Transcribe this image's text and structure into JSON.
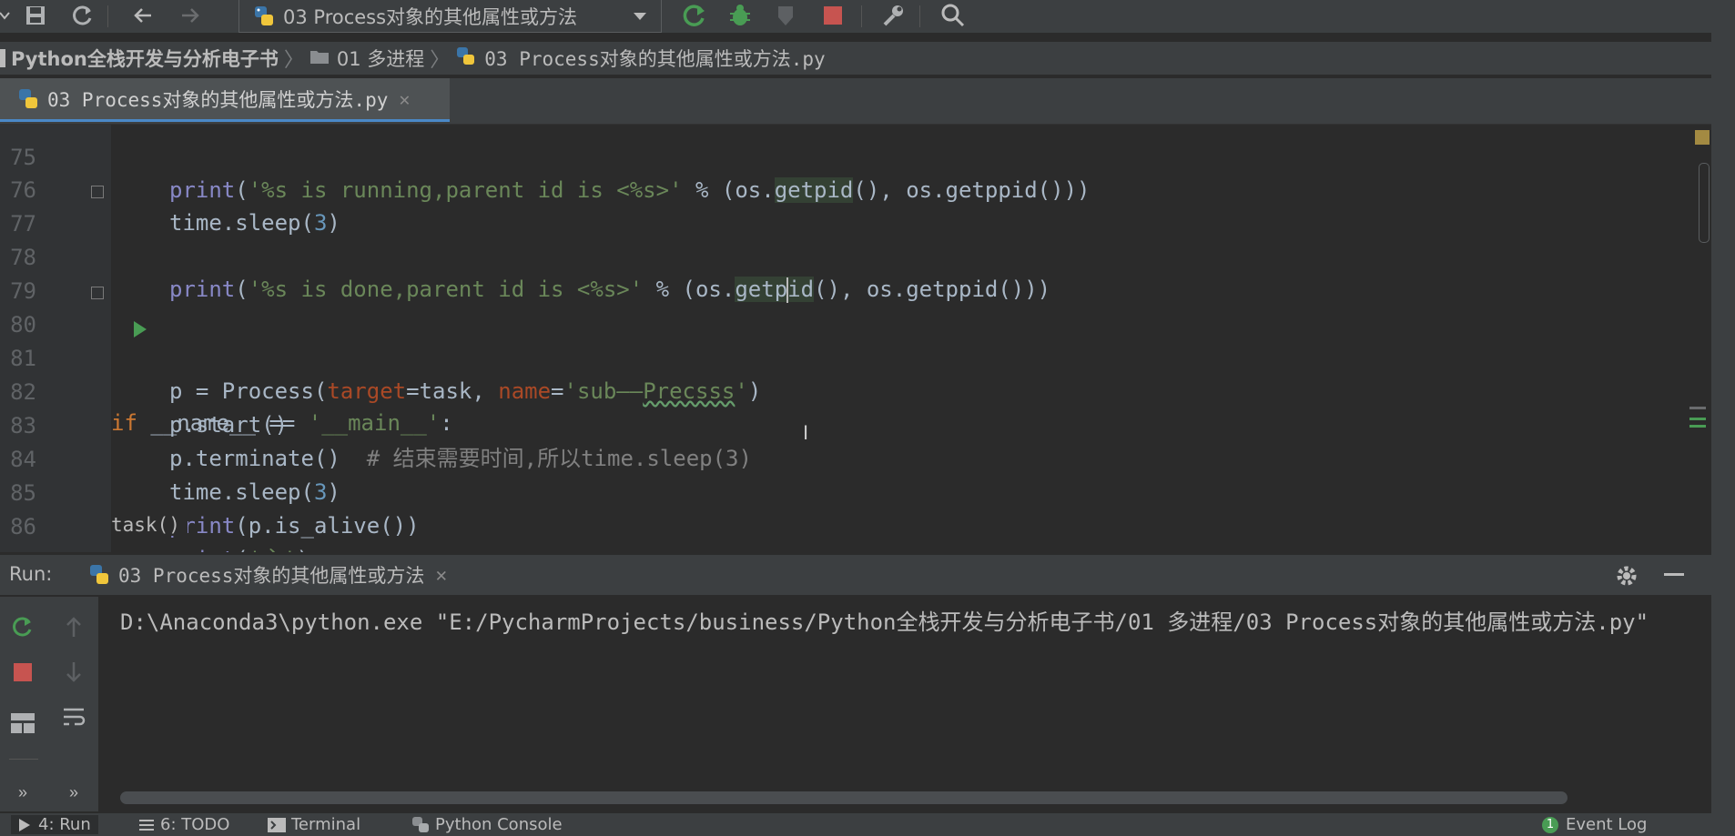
{
  "toolbar": {
    "run_config": "03 Process对象的其他属性或方法"
  },
  "breadcrumb": [
    "Python全栈开发与分析电子书",
    "01 多进程",
    "03 Process对象的其他属性或方法.py"
  ],
  "editor_tab": {
    "label": "03 Process对象的其他属性或方法.py"
  },
  "editor": {
    "hint": "task()"
  },
  "run_panel": {
    "title": "Run:",
    "tab_label": "03 Process对象的其他属性或方法",
    "console_line": "D:\\Anaconda3\\python.exe \"E:/PycharmProjects/business/Python全栈开发与分析电子书/01 多进程/03 Process对象的其他属性或方法.py\""
  },
  "statusbar": {
    "run": "4: Run",
    "todo": "6: TODO",
    "terminal": "Terminal",
    "python_console": "Python Console",
    "event_count": "1",
    "event_log": "Event Log"
  },
  "code_lines": [
    {
      "n": "75"
    },
    {
      "n": "76"
    },
    {
      "n": "77"
    },
    {
      "n": "78"
    },
    {
      "n": "79"
    },
    {
      "n": "80"
    },
    {
      "n": "81"
    },
    {
      "n": "82"
    },
    {
      "n": "83"
    },
    {
      "n": "84"
    },
    {
      "n": "85"
    },
    {
      "n": "86"
    }
  ],
  "colors": {
    "background": "#2b2b2b",
    "keyword": "#cc7832",
    "string": "#6a8759",
    "number": "#6897bb",
    "comment": "#808080",
    "run_green": "#499c54",
    "stop_red": "#c75450"
  }
}
